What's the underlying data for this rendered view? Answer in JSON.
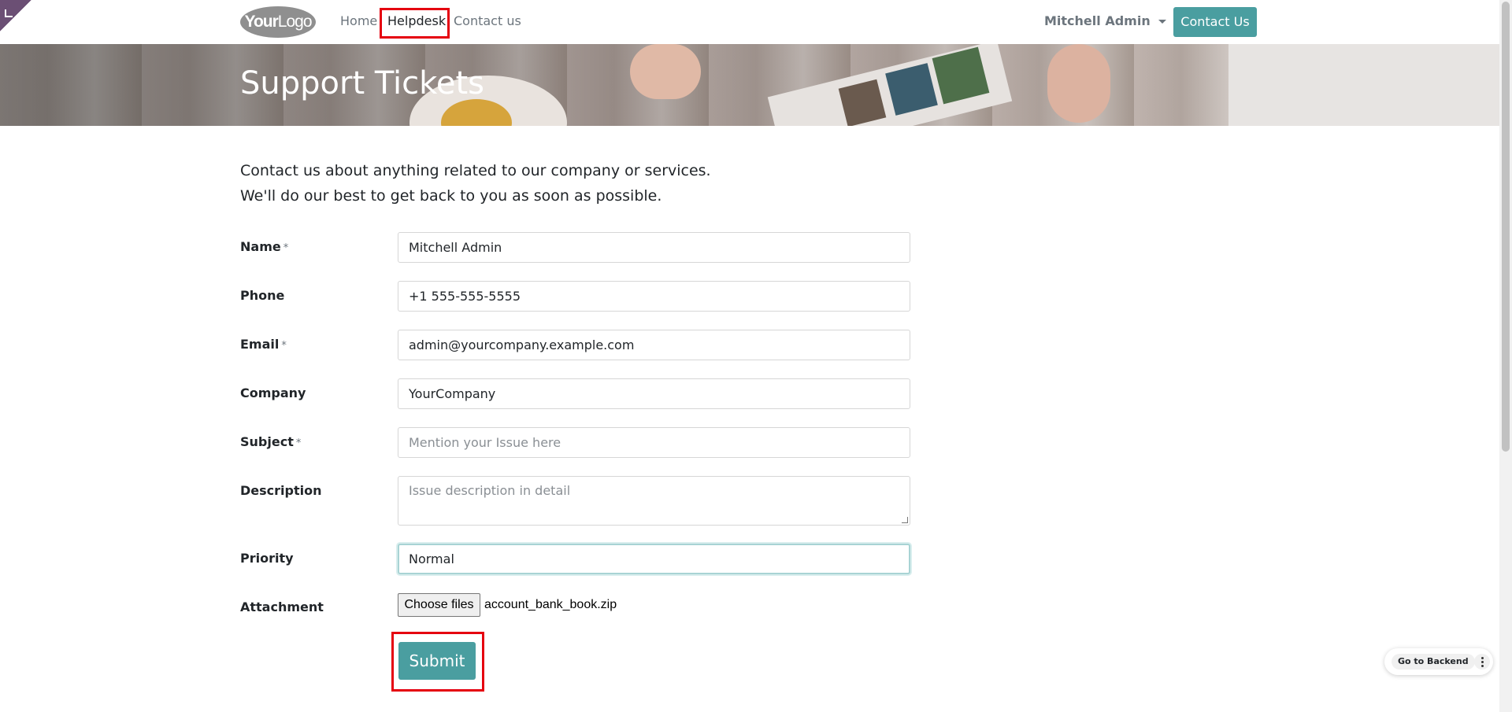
{
  "nav": {
    "logo_bold": "Your",
    "logo_rest": "Logo",
    "links": [
      "Home",
      "Helpdesk",
      "Contact us"
    ],
    "user": "Mitchell Admin",
    "contact_button": "Contact Us"
  },
  "banner": {
    "title": "Support Tickets"
  },
  "intro": {
    "line1": "Contact us about anything related to our company or services.",
    "line2": "We'll do our best to get back to you as soon as possible."
  },
  "form": {
    "required_mark": "*",
    "name": {
      "label": "Name",
      "value": "Mitchell Admin"
    },
    "phone": {
      "label": "Phone",
      "value": "+1 555-555-5555"
    },
    "email": {
      "label": "Email",
      "value": "admin@yourcompany.example.com"
    },
    "company": {
      "label": "Company",
      "value": "YourCompany"
    },
    "subject": {
      "label": "Subject",
      "placeholder": "Mention your Issue here"
    },
    "description": {
      "label": "Description",
      "placeholder": "Issue description in detail"
    },
    "priority": {
      "label": "Priority",
      "value": "Normal"
    },
    "attachment": {
      "label": "Attachment",
      "button": "Choose files",
      "file": "account_bank_book.zip"
    },
    "submit": "Submit"
  },
  "backend": {
    "label": "Go to Backend"
  },
  "colors": {
    "accent": "#4a9ea0",
    "highlight": "#e5000f"
  }
}
